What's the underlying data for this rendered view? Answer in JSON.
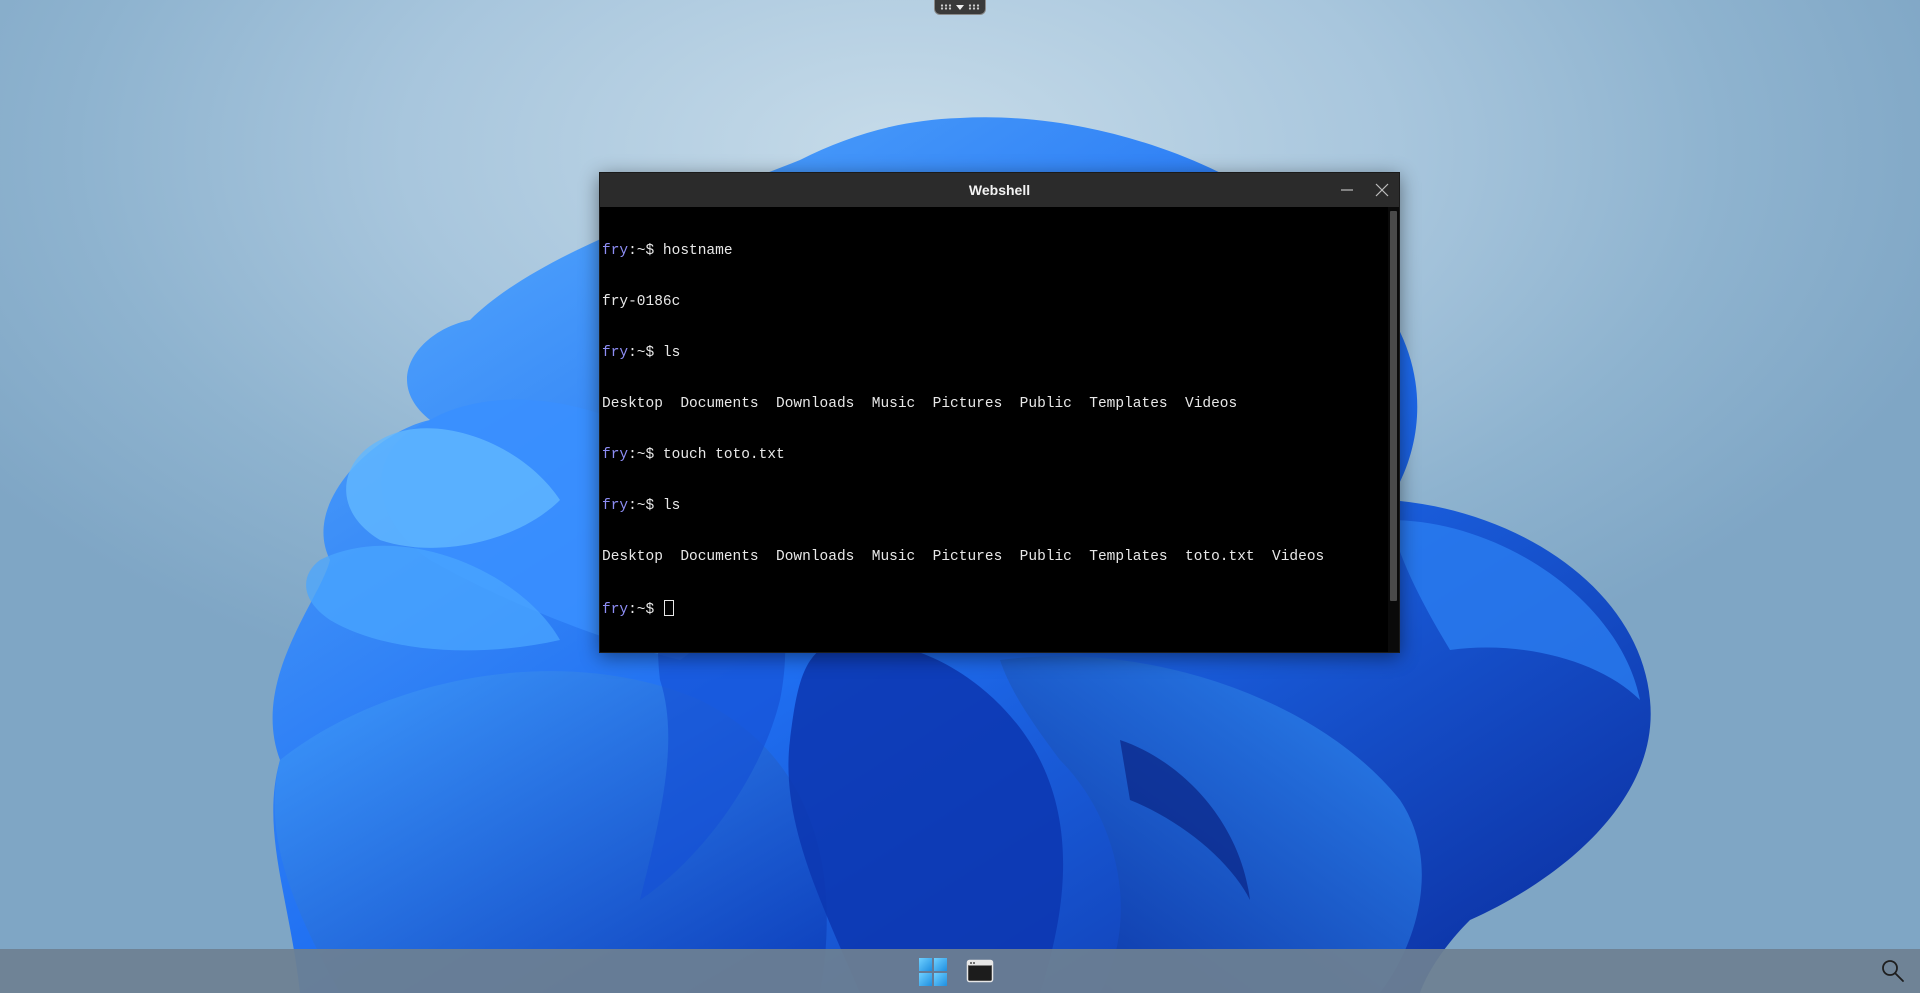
{
  "window": {
    "title": "Webshell",
    "controls": {
      "minimize_icon": "minimize-icon",
      "close_icon": "close-icon"
    }
  },
  "terminal": {
    "prompt_user": "fry",
    "prompt_suffix": ":~$",
    "lines": [
      {
        "type": "cmd",
        "text": " hostname"
      },
      {
        "type": "out",
        "text": "fry-0186c"
      },
      {
        "type": "cmd",
        "text": " ls"
      },
      {
        "type": "out",
        "text": "Desktop  Documents  Downloads  Music  Pictures  Public  Templates  Videos"
      },
      {
        "type": "cmd",
        "text": " touch toto.txt"
      },
      {
        "type": "cmd",
        "text": " ls"
      },
      {
        "type": "out",
        "text": "Desktop  Documents  Downloads  Music  Pictures  Public  Templates  toto.txt  Videos"
      },
      {
        "type": "cmd",
        "text": " "
      }
    ]
  },
  "taskbar": {
    "start_icon": "windows-start-icon",
    "app_icon": "terminal-app-icon",
    "search_icon": "search-icon"
  },
  "colors": {
    "prompt_user": "#8e8ef5",
    "terminal_bg": "#000000",
    "titlebar_bg": "#2b2b2b",
    "taskbar_bg": "#6e8091"
  }
}
